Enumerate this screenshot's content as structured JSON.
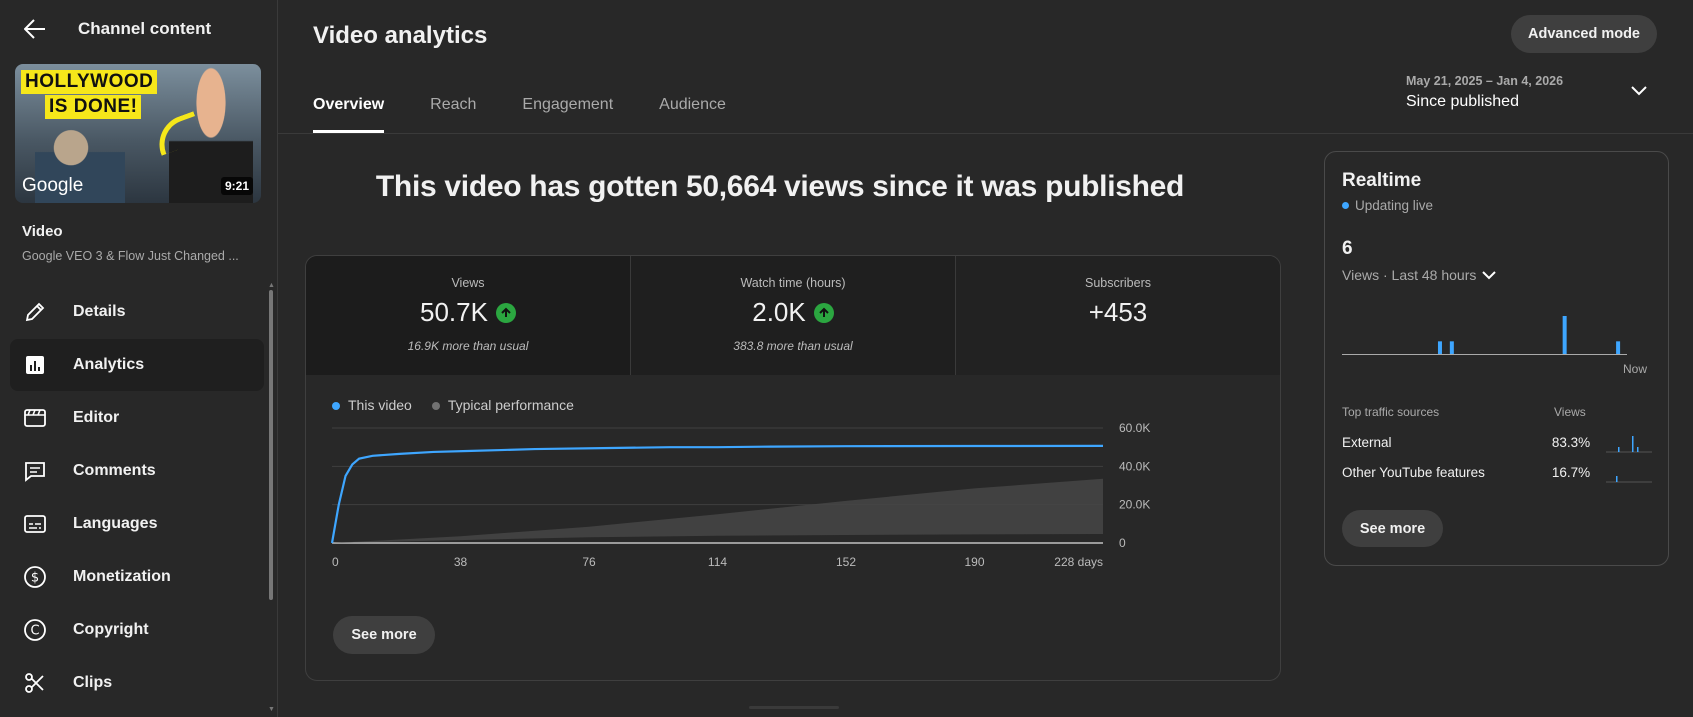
{
  "sidebar": {
    "header_title": "Channel content",
    "thumbnail": {
      "banner_line1": "HOLLYWOOD",
      "banner_line2": "IS DONE!",
      "logo_text": "Google",
      "duration": "9:21"
    },
    "video_label": "Video",
    "video_title": "Google VEO 3 & Flow Just Changed ...",
    "items": [
      {
        "label": "Details",
        "icon": "pencil-icon"
      },
      {
        "label": "Analytics",
        "icon": "analytics-icon",
        "active": true
      },
      {
        "label": "Editor",
        "icon": "clapperboard-icon"
      },
      {
        "label": "Comments",
        "icon": "comment-icon"
      },
      {
        "label": "Languages",
        "icon": "subtitles-icon"
      },
      {
        "label": "Monetization",
        "icon": "dollar-icon"
      },
      {
        "label": "Copyright",
        "icon": "copyright-icon"
      },
      {
        "label": "Clips",
        "icon": "scissors-icon"
      }
    ]
  },
  "header": {
    "title": "Video analytics",
    "advanced_mode": "Advanced mode",
    "tabs": [
      {
        "label": "Overview",
        "active": true
      },
      {
        "label": "Reach"
      },
      {
        "label": "Engagement"
      },
      {
        "label": "Audience"
      }
    ],
    "date_range": "May 21, 2025 – Jan 4, 2026",
    "date_label": "Since published"
  },
  "headline": "This video has gotten 50,664 views since it was published",
  "metrics": [
    {
      "label": "Views",
      "value": "50.7K",
      "trend": "up",
      "sub": "16.9K more than usual"
    },
    {
      "label": "Watch time (hours)",
      "value": "2.0K",
      "trend": "up",
      "sub": "383.8 more than usual"
    },
    {
      "label": "Subscribers",
      "value": "+453"
    }
  ],
  "chart_data": {
    "type": "line",
    "legend": [
      {
        "name": "This video",
        "color": "#3ea6ff"
      },
      {
        "name": "Typical performance",
        "color": "#717171"
      }
    ],
    "x_ticks": [
      "0",
      "38",
      "76",
      "114",
      "152",
      "190",
      "228 days"
    ],
    "y_ticks": [
      "0",
      "20.0K",
      "40.0K",
      "60.0K"
    ],
    "ylim": [
      0,
      60000
    ],
    "xlim": [
      0,
      228
    ],
    "series": [
      {
        "name": "This video",
        "x": [
          0,
          2,
          4,
          6,
          8,
          12,
          20,
          30,
          40,
          50,
          60,
          80,
          100,
          114,
          130,
          152,
          190,
          228
        ],
        "values": [
          0,
          20000,
          35000,
          41000,
          44000,
          45500,
          46500,
          47500,
          48000,
          48500,
          49000,
          49500,
          50000,
          50000,
          50300,
          50500,
          50600,
          50664
        ]
      },
      {
        "name": "Typical performance",
        "x": [
          0,
          38,
          76,
          114,
          152,
          190,
          228
        ],
        "upper": [
          0,
          3500,
          8500,
          15000,
          22000,
          28500,
          33500
        ],
        "lower": [
          0,
          1500,
          3000,
          3800,
          4200,
          4500,
          4700
        ]
      }
    ],
    "grid": true,
    "legend_position": "top-left"
  },
  "see_more": "See more",
  "realtime": {
    "title": "Realtime",
    "status": "Updating live",
    "count": "6",
    "period": "Views · Last 48 hours",
    "now_label": "Now",
    "bars": [
      0,
      0,
      0,
      0,
      0,
      0,
      0,
      0,
      0,
      0,
      0,
      0,
      0,
      0,
      0,
      0,
      1,
      0,
      1,
      0,
      0,
      0,
      0,
      0,
      0,
      0,
      0,
      0,
      0,
      0,
      0,
      0,
      0,
      0,
      0,
      0,
      0,
      3,
      0,
      0,
      0,
      0,
      0,
      0,
      0,
      0,
      1,
      0
    ],
    "traffic_header": "Top traffic sources",
    "views_header": "Views",
    "sources": [
      {
        "name": "External",
        "pct": "83.3%"
      },
      {
        "name": "Other YouTube features",
        "pct": "16.7%"
      }
    ],
    "see_more": "See more",
    "accent": "#3ea6ff"
  }
}
